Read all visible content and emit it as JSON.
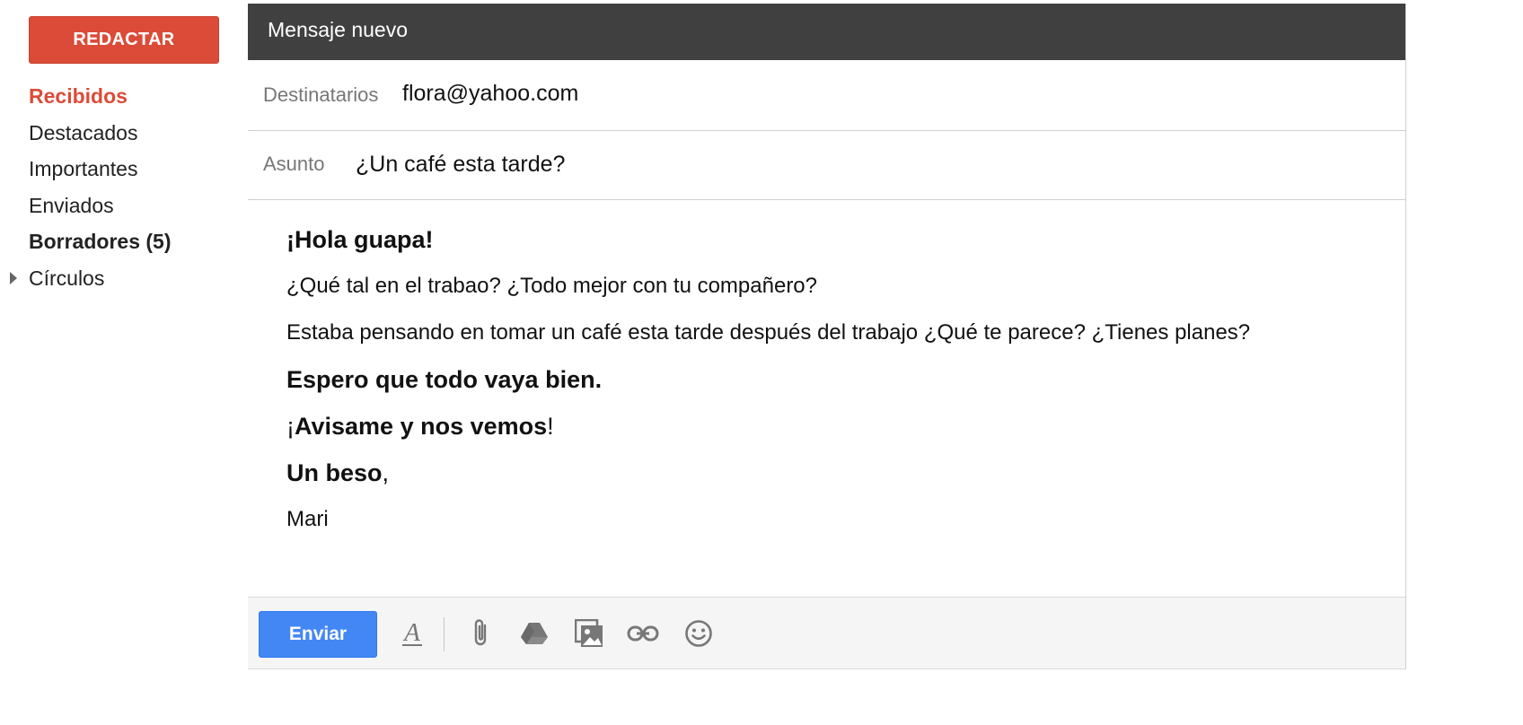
{
  "sidebar": {
    "compose_label": "REDACTAR",
    "items": [
      {
        "label": "Recibidos"
      },
      {
        "label": "Destacados"
      },
      {
        "label": "Importantes"
      },
      {
        "label": "Enviados"
      },
      {
        "label": "Borradores (5)"
      },
      {
        "label": "Círculos"
      }
    ]
  },
  "compose": {
    "title": "Mensaje nuevo",
    "to_label": "Destinatarios",
    "to_value": "flora@yahoo.com",
    "subject_label": "Asunto",
    "subject_value": "¿Un café esta tarde?",
    "body": {
      "greeting": "¡Hola guapa!",
      "line1": "¿Qué tal en el trabao? ¿Todo mejor con tu compañero?",
      "line2": "Estaba pensando en tomar un café esta tarde después del trabajo ¿Qué te parece? ¿Tienes planes?",
      "line3": "Espero que todo vaya bien.",
      "line4_prefix": "¡",
      "line4_bold": "Avisame y nos vemos",
      "line4_suffix": "!",
      "closing_bold": "Un beso",
      "closing_suffix": ",",
      "signature": "Mari"
    }
  },
  "toolbar": {
    "send_label": "Enviar",
    "format_glyph": "A"
  },
  "colors": {
    "compose_button": "#dc4b38",
    "active_nav": "#dc4b38",
    "header_bg": "#404040",
    "send_button": "#4387f5"
  },
  "icons": [
    "caret-right-icon",
    "text-format-icon",
    "paperclip-icon",
    "drive-icon",
    "photo-icon",
    "link-icon",
    "emoji-icon"
  ]
}
